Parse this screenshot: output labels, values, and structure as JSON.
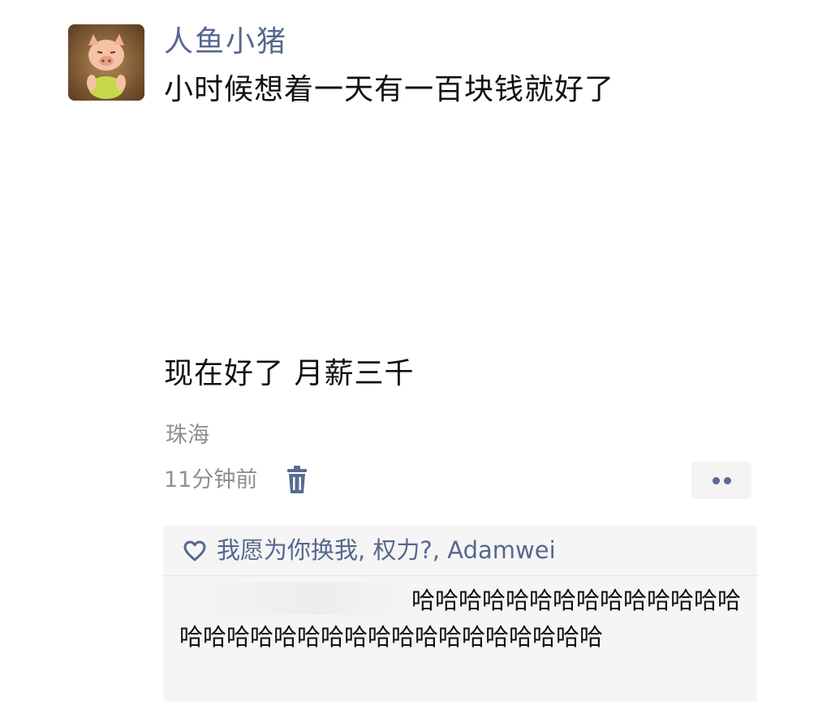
{
  "post": {
    "author": "人鱼小猪",
    "avatar_icon": "pig-figurine-avatar",
    "text_line_1": "小时候想着一天有一百块钱就好了",
    "text_line_2": "现在好了 月薪三千",
    "location": "珠海",
    "time": "11分钟前",
    "delete_icon": "trash-icon",
    "more_icon": "more-dots-icon"
  },
  "interactions": {
    "heart_icon": "heart-icon",
    "likes": "我愿为你换我, 权力?, Adamwei",
    "comment": {
      "author": "",
      "text": "哈哈哈哈哈哈哈哈哈哈哈哈哈哈哈哈哈哈哈哈哈哈哈哈哈哈哈哈哈哈哈哈"
    }
  },
  "colors": {
    "link_blue": "#56678f",
    "text_black": "#111111",
    "meta_gray": "#8f8f8f",
    "panel_bg": "#f5f5f5"
  }
}
